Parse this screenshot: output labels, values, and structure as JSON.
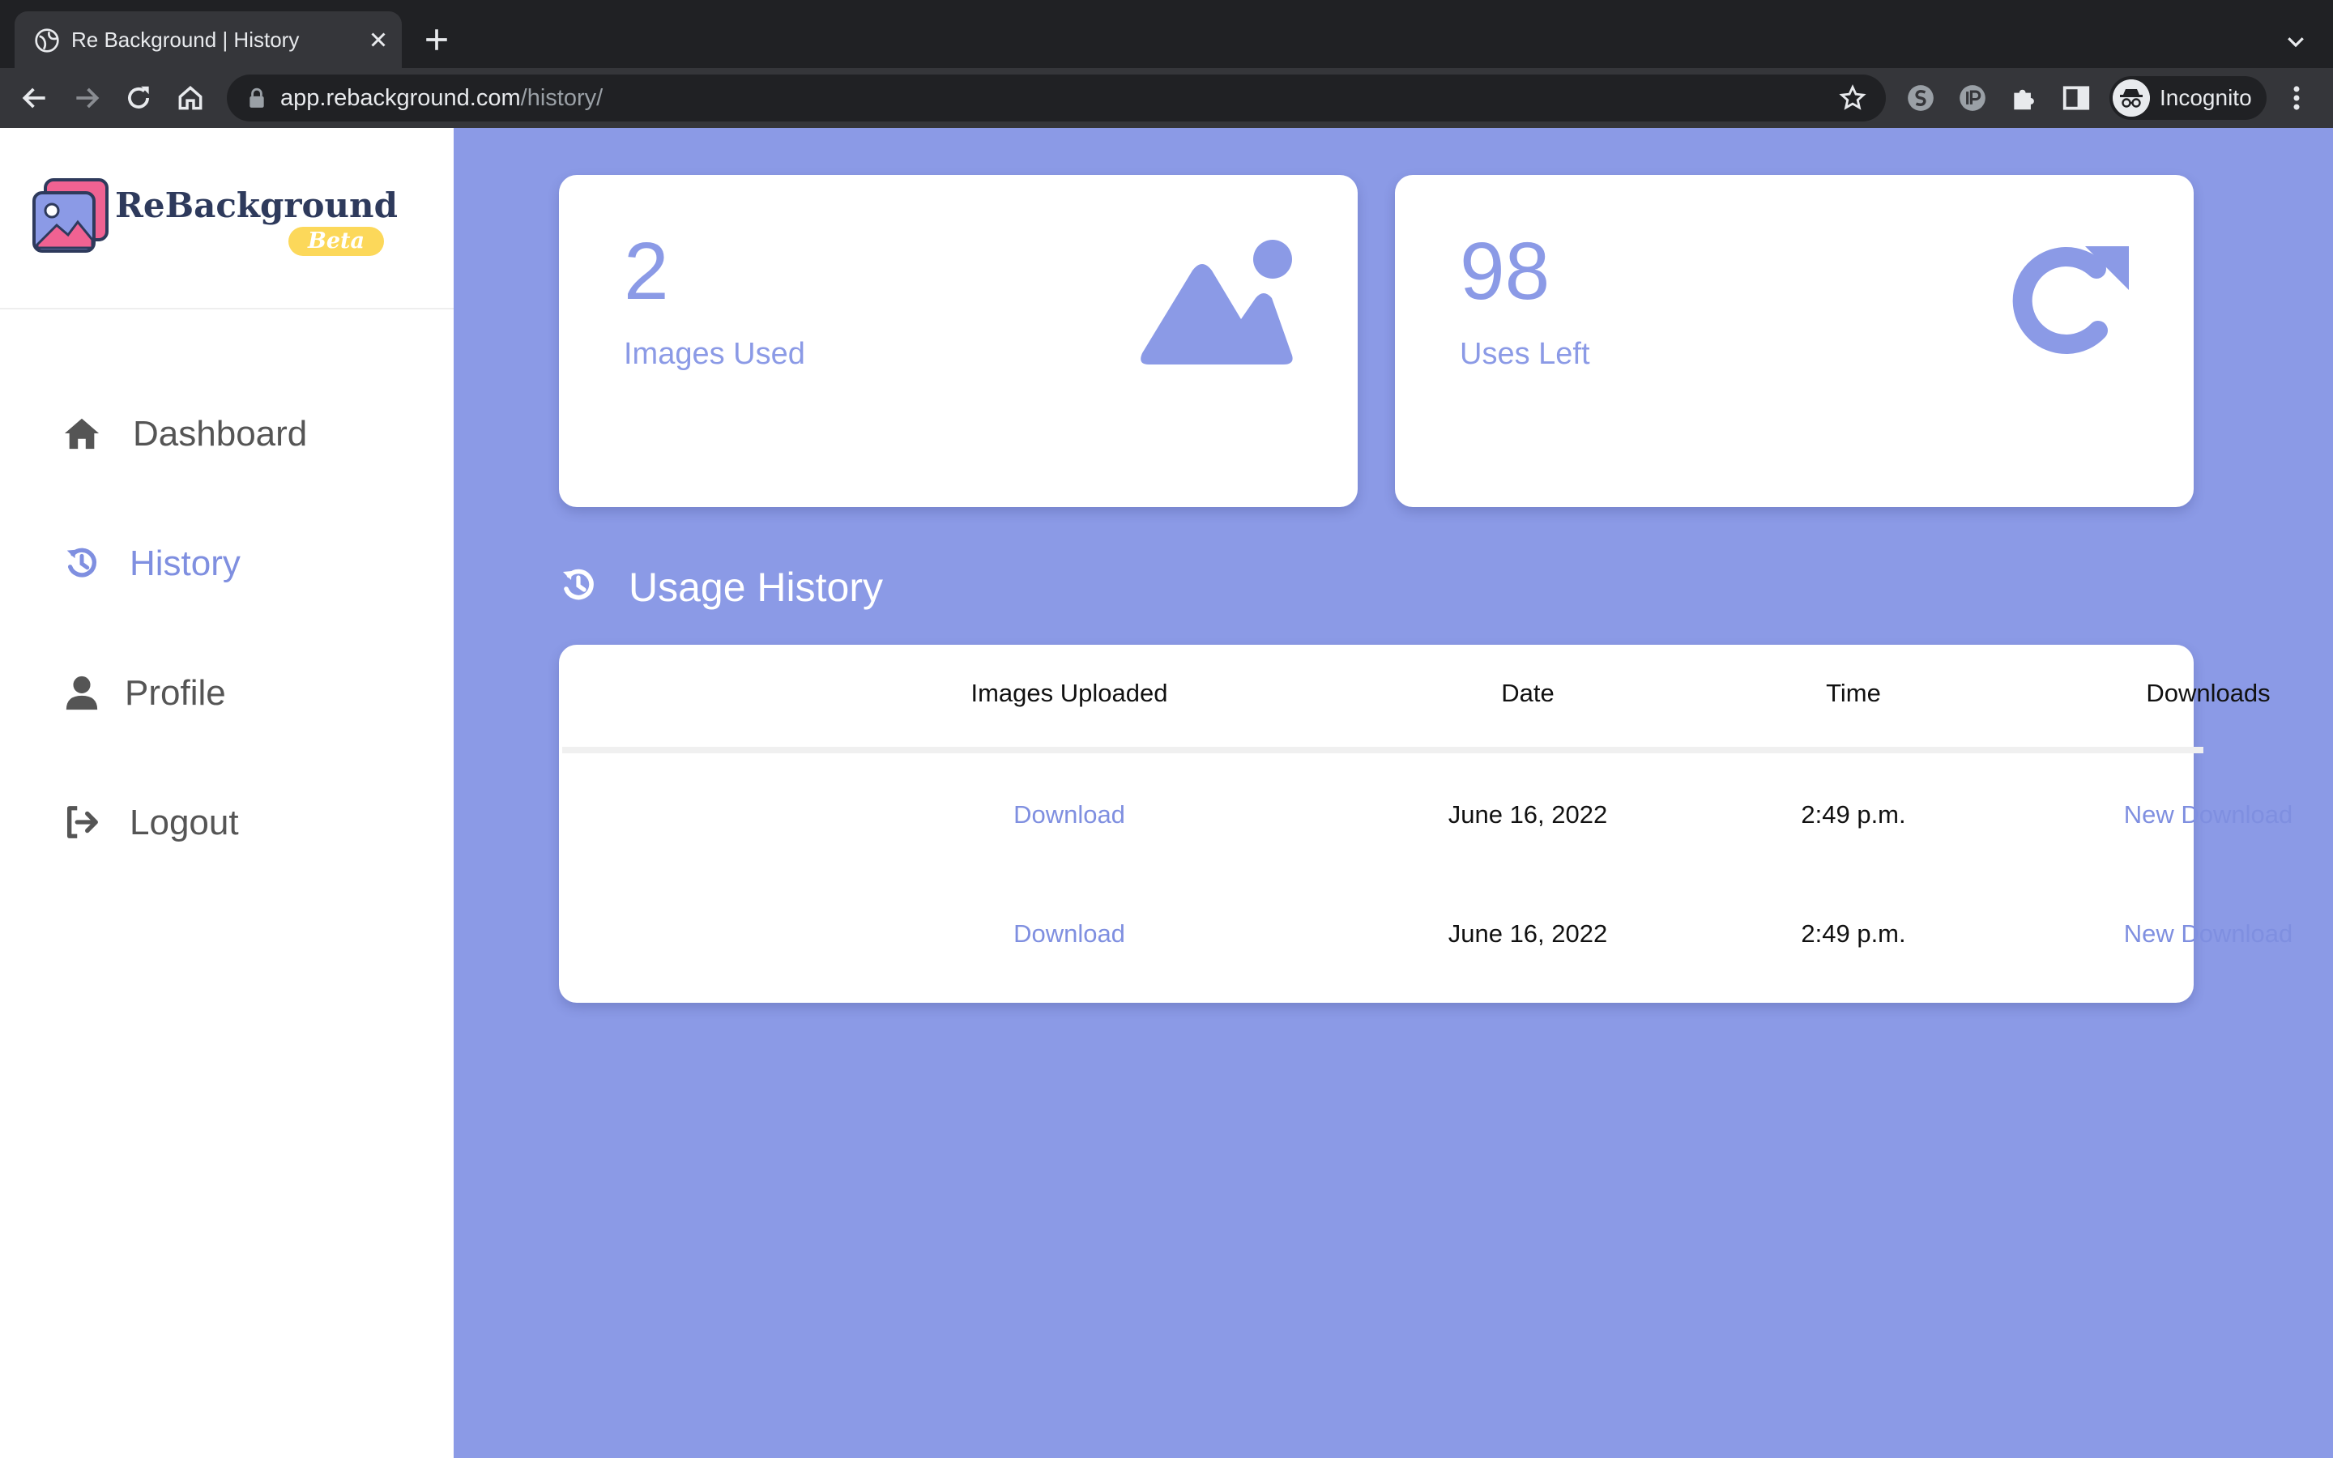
{
  "browser": {
    "tab_title": "Re Background | History",
    "url_host": "app.rebackground.com",
    "url_path": "/history/",
    "profile_label": "Incognito"
  },
  "brand": {
    "name": "ReBackground",
    "badge": "Beta",
    "accent": "#8b9ae6",
    "badge_color": "#fcd85a",
    "dark": "#2e3a5c",
    "pink": "#f06292"
  },
  "sidebar": {
    "items": [
      {
        "label": "Dashboard",
        "icon": "home-icon",
        "active": false
      },
      {
        "label": "History",
        "icon": "history-icon",
        "active": true
      },
      {
        "label": "Profile",
        "icon": "user-icon",
        "active": false
      },
      {
        "label": "Logout",
        "icon": "logout-icon",
        "active": false
      }
    ]
  },
  "stats": [
    {
      "value": "2",
      "label": "Images Used",
      "icon": "image-icon"
    },
    {
      "value": "98",
      "label": "Uses Left",
      "icon": "redo-icon"
    }
  ],
  "history": {
    "title": "Usage History",
    "columns": [
      "Images Uploaded",
      "Date",
      "Time",
      "Downloads"
    ],
    "rows": [
      {
        "image": "Download",
        "date": "June 16, 2022",
        "time": "2:49 p.m.",
        "download": "New Download"
      },
      {
        "image": "Download",
        "date": "June 16, 2022",
        "time": "2:49 p.m.",
        "download": "New Download"
      }
    ]
  }
}
